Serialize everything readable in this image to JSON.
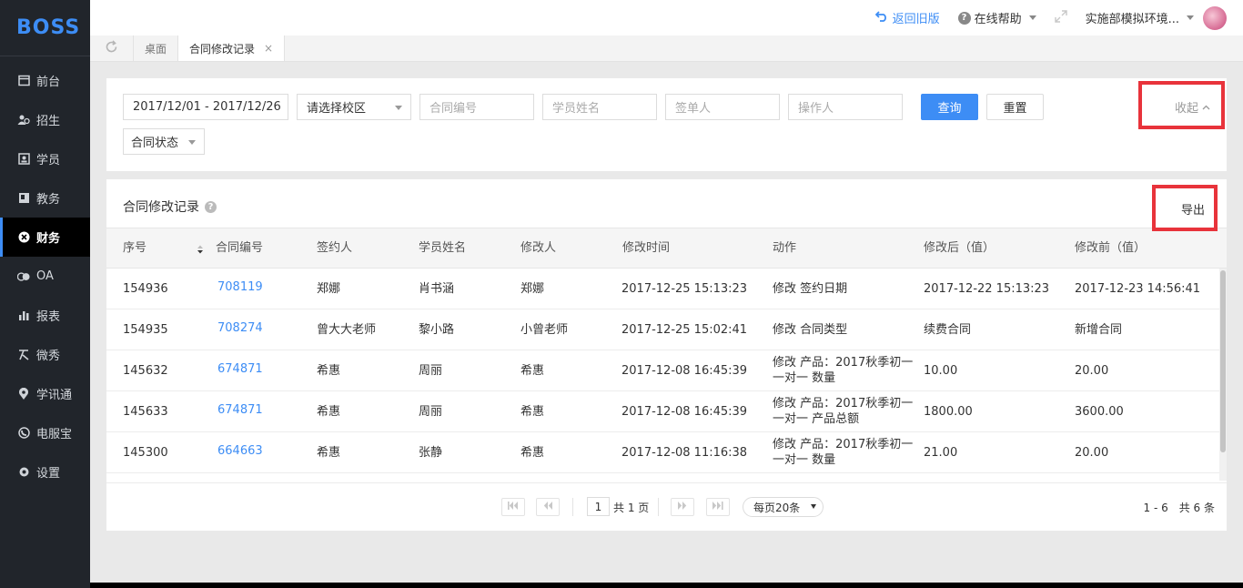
{
  "app": {
    "logo": "BOSS"
  },
  "sidebar": {
    "items": [
      {
        "label": "前台",
        "icon": "calendar-icon"
      },
      {
        "label": "招生",
        "icon": "people-icon"
      },
      {
        "label": "学员",
        "icon": "student-card-icon"
      },
      {
        "label": "教务",
        "icon": "book-icon"
      },
      {
        "label": "财务",
        "icon": "finance-icon",
        "active": true
      },
      {
        "label": "OA",
        "icon": "oa-icon"
      },
      {
        "label": "报表",
        "icon": "bar-chart-icon"
      },
      {
        "label": "微秀",
        "icon": "weixiu-icon"
      },
      {
        "label": "学讯通",
        "icon": "location-pin-icon"
      },
      {
        "label": "电服宝",
        "icon": "phone-icon"
      },
      {
        "label": "设置",
        "icon": "gear-icon"
      }
    ]
  },
  "header": {
    "back_old": "返回旧版",
    "help": "在线帮助",
    "user": "实施部模拟环境..."
  },
  "tabs": [
    {
      "label": "桌面"
    },
    {
      "label": "合同修改记录",
      "active": true,
      "close": "×"
    }
  ],
  "filter": {
    "date_range": "2017/12/01 - 2017/12/26",
    "campus_select": "请选择校区",
    "contract_no_ph": "合同编号",
    "student_name_ph": "学员姓名",
    "signer_ph": "签单人",
    "operator_ph": "操作人",
    "search_btn": "查询",
    "reset_btn": "重置",
    "collapse": "收起",
    "contract_status": "合同状态"
  },
  "table": {
    "title": "合同修改记录",
    "export": "导出",
    "columns": [
      "序号",
      "合同编号",
      "签约人",
      "学员姓名",
      "修改人",
      "修改时间",
      "动作",
      "修改后（值）",
      "修改前（值）"
    ],
    "rows": [
      {
        "id": "154936",
        "contract": "708119",
        "signer": "郑娜",
        "student": "肖书涵",
        "modifier": "郑娜",
        "time": "2017-12-25 15:13:23",
        "action": "修改 签约日期",
        "after": "2017-12-22 15:13:23",
        "before": "2017-12-23 14:56:41"
      },
      {
        "id": "154935",
        "contract": "708274",
        "signer": "曾大大老师",
        "student": "黎小路",
        "modifier": "小曾老师",
        "time": "2017-12-25 15:02:41",
        "action": "修改 合同类型",
        "after": "续费合同",
        "before": "新增合同"
      },
      {
        "id": "145632",
        "contract": "674871",
        "signer": "希惠",
        "student": "周丽",
        "modifier": "希惠",
        "time": "2017-12-08 16:45:39",
        "action": "修改 产品：2017秋季初一一对一 数量",
        "after": "10.00",
        "before": "20.00"
      },
      {
        "id": "145633",
        "contract": "674871",
        "signer": "希惠",
        "student": "周丽",
        "modifier": "希惠",
        "time": "2017-12-08 16:45:39",
        "action": "修改 产品：2017秋季初一一对一 产品总额",
        "after": "1800.00",
        "before": "3600.00"
      },
      {
        "id": "145300",
        "contract": "664663",
        "signer": "希惠",
        "student": "张静",
        "modifier": "希惠",
        "time": "2017-12-08 11:16:38",
        "action": "修改 产品：2017秋季初一一对一 数量",
        "after": "21.00",
        "before": "20.00"
      }
    ]
  },
  "pager": {
    "page": "1",
    "total_pages": "共 1 页",
    "per_page": "每页20条",
    "summary": "1 - 6　共 6 条"
  },
  "colors": {
    "accent": "#3d8df5",
    "sidebar_bg": "#21252b",
    "highlight_red": "#e8333b"
  }
}
